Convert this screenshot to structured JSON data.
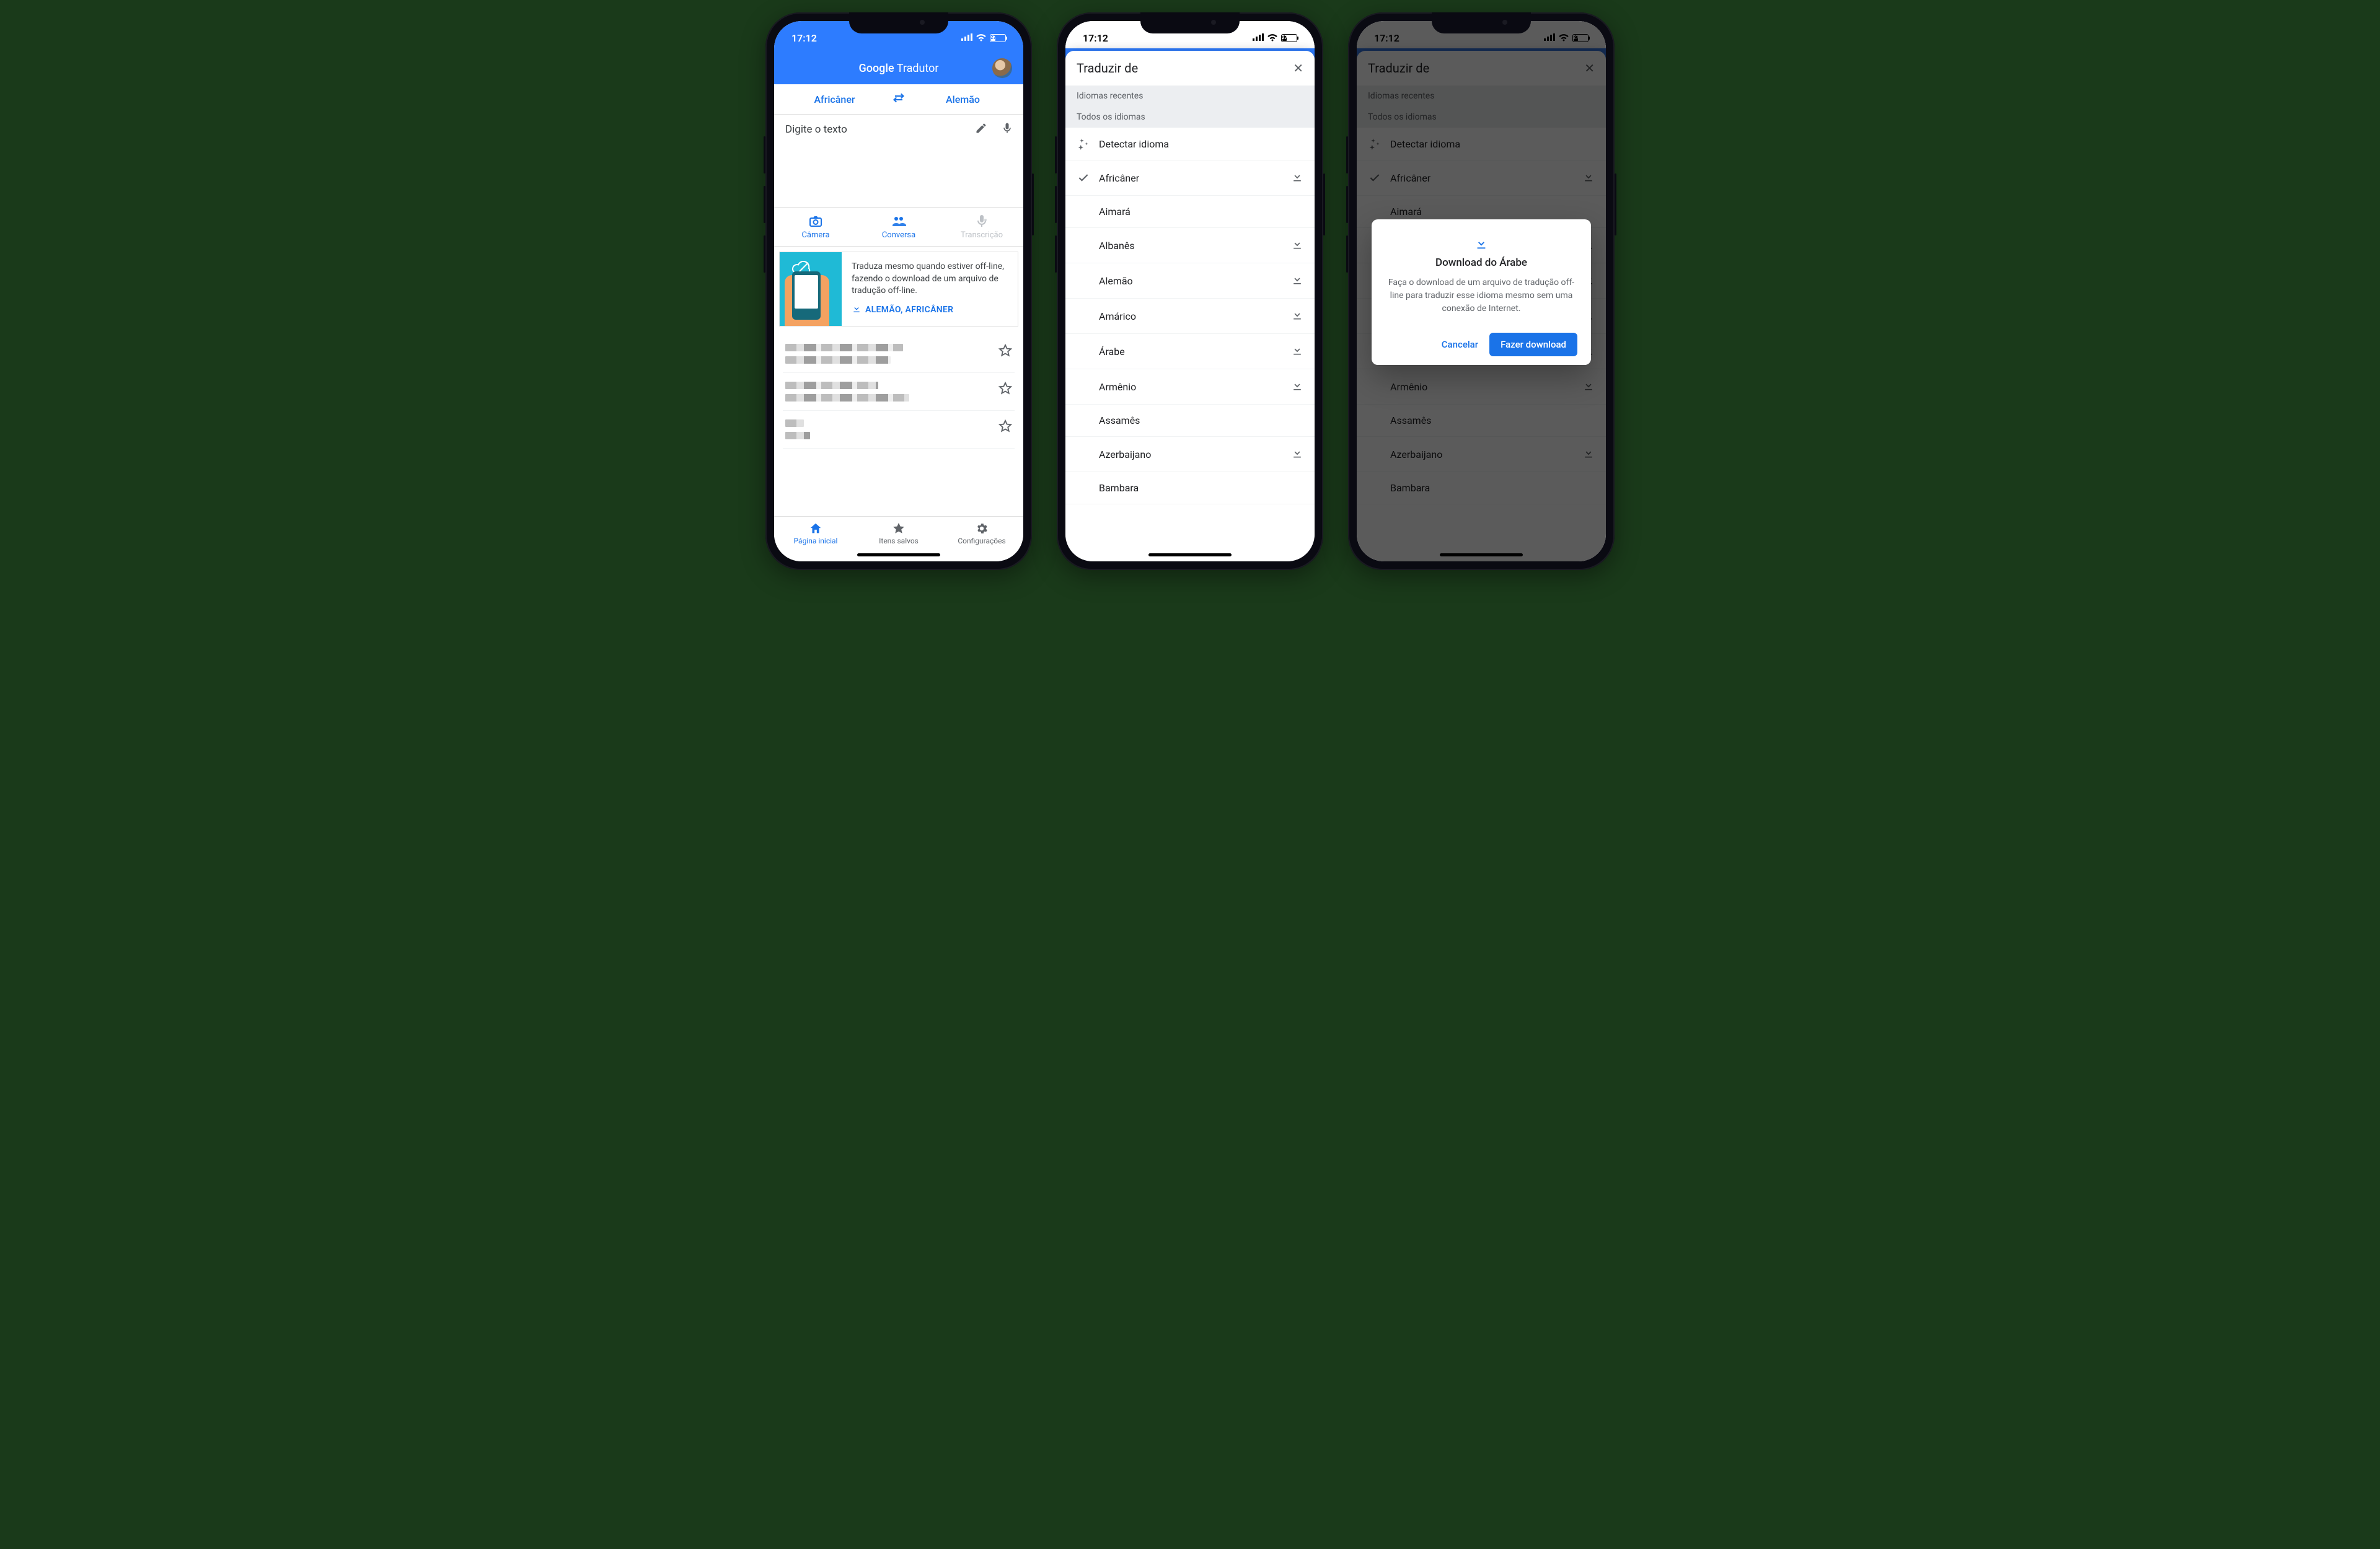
{
  "status": {
    "time": "17:12",
    "battery": "27"
  },
  "phone1": {
    "app_title_a": "Google",
    "app_title_b": "Tradutor",
    "lang_from": "Africâner",
    "lang_to": "Alemão",
    "placeholder": "Digite o texto",
    "modes": {
      "camera": "Câmera",
      "conversation": "Conversa",
      "transcription": "Transcrição"
    },
    "promo": {
      "text": "Traduza mesmo quando estiver off-line, fazendo o download de um arquivo de tradução off-line.",
      "cta": "ALEMÃO, AFRICÂNER"
    },
    "tabs": {
      "home": "Página inicial",
      "saved": "Itens salvos",
      "settings": "Configurações"
    }
  },
  "langsheet": {
    "title": "Traduzir de",
    "section_recent": "Idiomas recentes",
    "section_all": "Todos os idiomas",
    "detect": "Detectar idioma",
    "items": [
      {
        "name": "Africâner",
        "selected": true,
        "downloadable": true
      },
      {
        "name": "Aimará",
        "selected": false,
        "downloadable": false
      },
      {
        "name": "Albanês",
        "selected": false,
        "downloadable": true
      },
      {
        "name": "Alemão",
        "selected": false,
        "downloadable": true
      },
      {
        "name": "Amárico",
        "selected": false,
        "downloadable": true
      },
      {
        "name": "Árabe",
        "selected": false,
        "downloadable": true
      },
      {
        "name": "Armênio",
        "selected": false,
        "downloadable": true
      },
      {
        "name": "Assamês",
        "selected": false,
        "downloadable": false
      },
      {
        "name": "Azerbaijano",
        "selected": false,
        "downloadable": true
      },
      {
        "name": "Bambara",
        "selected": false,
        "downloadable": false
      }
    ]
  },
  "dialog": {
    "title": "Download do Árabe",
    "body": "Faça o download de um arquivo de tradução off-line para traduzir esse idioma mesmo sem uma conexão de Internet.",
    "cancel": "Cancelar",
    "confirm": "Fazer download"
  }
}
